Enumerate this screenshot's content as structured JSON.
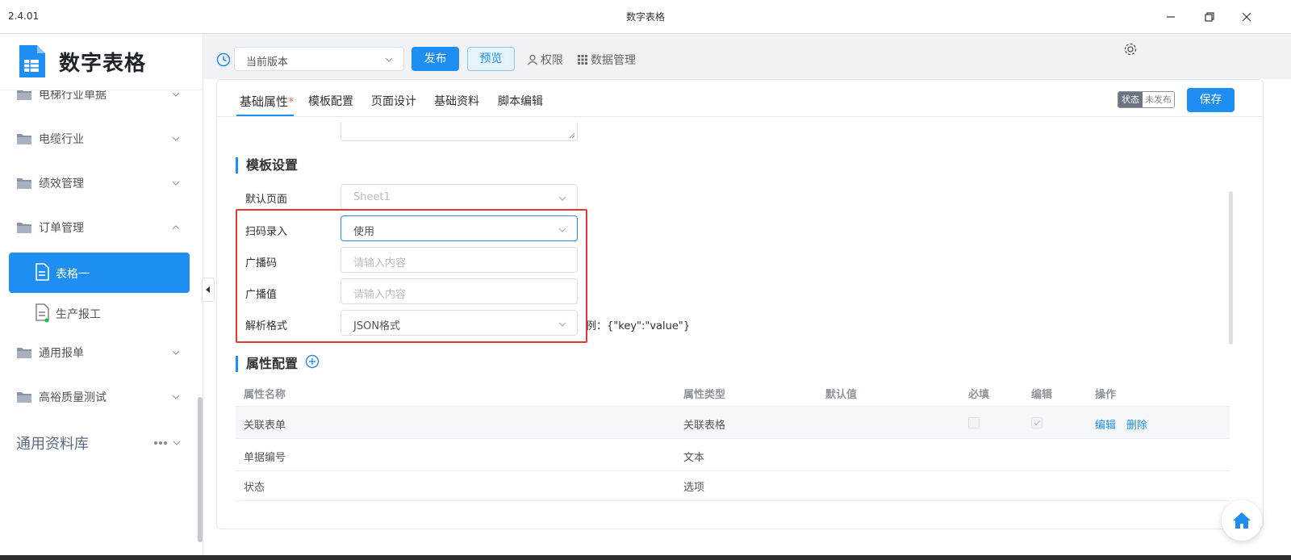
{
  "window": {
    "version": "2.4.01",
    "title": "数字表格"
  },
  "sidebar": {
    "logo_text": "数字表格",
    "items": [
      {
        "label": "电梯行业单据"
      },
      {
        "label": "电缆行业"
      },
      {
        "label": "绩效管理"
      },
      {
        "label": "订单管理"
      },
      {
        "label": "通用报单"
      },
      {
        "label": "高裕质量测试"
      }
    ],
    "sub_items": [
      {
        "label": "表格一",
        "active": true
      },
      {
        "label": "生产报工",
        "active": false
      }
    ],
    "library": "通用资料库"
  },
  "toolbar": {
    "version_value": "当前版本",
    "publish": "发布",
    "preview": "预览",
    "permission": "权限",
    "data_manage": "数据管理"
  },
  "tabs": [
    {
      "label": "基础属性",
      "required": "*"
    },
    {
      "label": "模板配置"
    },
    {
      "label": "页面设计"
    },
    {
      "label": "基础资料"
    },
    {
      "label": "脚本编辑"
    }
  ],
  "status": {
    "key": "状态",
    "value": "未发布"
  },
  "save": "保存",
  "template_section": {
    "title": "模板设置",
    "fields": [
      {
        "label": "默认页面",
        "value": "Sheet1",
        "type": "select"
      },
      {
        "label": "扫码录入",
        "value": "使用",
        "type": "select"
      },
      {
        "label": "广播码",
        "placeholder": "请输入内容",
        "type": "input"
      },
      {
        "label": "广播值",
        "placeholder": "请输入内容",
        "type": "input"
      },
      {
        "label": "解析格式",
        "value": "JSON格式",
        "type": "select"
      }
    ],
    "hint": "例：{\"key\":\"value\"}"
  },
  "attr_section": {
    "title": "属性配置",
    "headers": [
      "属性名称",
      "属性类型",
      "默认值",
      "必填",
      "编辑",
      "操作"
    ],
    "rows": [
      {
        "name": "关联表单",
        "type": "关联表格",
        "default": "",
        "actions": [
          "编辑",
          "删除"
        ]
      },
      {
        "name": "单据编号",
        "type": "文本",
        "default": ""
      },
      {
        "name": "状态",
        "type": "选项",
        "default": ""
      }
    ]
  },
  "colors": {
    "accent": "#1e8ef3",
    "highlight_box": "#e53935"
  }
}
